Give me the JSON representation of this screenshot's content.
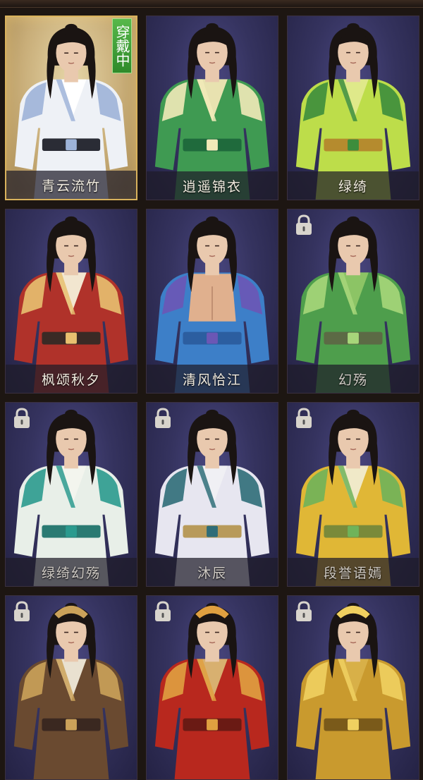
{
  "outfit_grid": {
    "wearing_label": "穿戴中",
    "outfits": [
      {
        "name": "青云流竹",
        "robe": "#eef1f6",
        "trim": "#9db3d8",
        "inner": "#ffffff",
        "belt": "#2a2c35",
        "bare": false,
        "locked": false,
        "selected": true
      },
      {
        "name": "逍遥锦衣",
        "robe": "#3f9a52",
        "trim": "#f1eab8",
        "inner": "#e8e2b0",
        "belt": "#1f6a3c",
        "bare": false,
        "locked": false,
        "selected": false
      },
      {
        "name": "绿绮",
        "robe": "#bddd4a",
        "trim": "#3c8d3c",
        "inner": "#dfe98a",
        "belt": "#b58b2e",
        "bare": false,
        "locked": false,
        "selected": false
      },
      {
        "name": "枫颂秋夕",
        "robe": "#b0322a",
        "trim": "#e8c070",
        "inner": "#f2e6d0",
        "belt": "#3a2a25",
        "bare": false,
        "locked": false,
        "selected": false
      },
      {
        "name": "清风恰江",
        "robe": "#3d7fc8",
        "trim": "#6b57b5",
        "inner": "#e0b08e",
        "belt": "#2c5ea0",
        "bare": true,
        "locked": false,
        "selected": false
      },
      {
        "name": "幻殇",
        "robe": "#4e9e4c",
        "trim": "#a7d67a",
        "inner": "#8cc465",
        "belt": "#5c6a45",
        "bare": false,
        "locked": true,
        "selected": false
      },
      {
        "name": "绿绮幻殇",
        "robe": "#e8efe8",
        "trim": "#2b9a8e",
        "inner": "#f3f5ee",
        "belt": "#2a7a72",
        "bare": false,
        "locked": true,
        "selected": false
      },
      {
        "name": "沐辰",
        "robe": "#e7e6f0",
        "trim": "#2f6d78",
        "inner": "#f0f0f4",
        "belt": "#b89a5a",
        "bare": false,
        "locked": true,
        "selected": false
      },
      {
        "name": "段誉语嫣",
        "robe": "#e0b736",
        "trim": "#6fb35a",
        "inner": "#f0e9c8",
        "belt": "#7a8a3a",
        "bare": false,
        "locked": true,
        "selected": false
      },
      {
        "name": "",
        "robe": "#6a4a30",
        "trim": "#cba25a",
        "inner": "#e9e1d0",
        "belt": "#3a2820",
        "bare": false,
        "locked": true,
        "selected": false
      },
      {
        "name": "",
        "robe": "#b8281e",
        "trim": "#e0a040",
        "inner": "#d8b070",
        "belt": "#6a1a14",
        "bare": false,
        "locked": true,
        "selected": false
      },
      {
        "name": "",
        "robe": "#c99a2e",
        "trim": "#f0d060",
        "inner": "#d8b048",
        "belt": "#7a5a1a",
        "bare": false,
        "locked": true,
        "selected": false
      }
    ]
  }
}
